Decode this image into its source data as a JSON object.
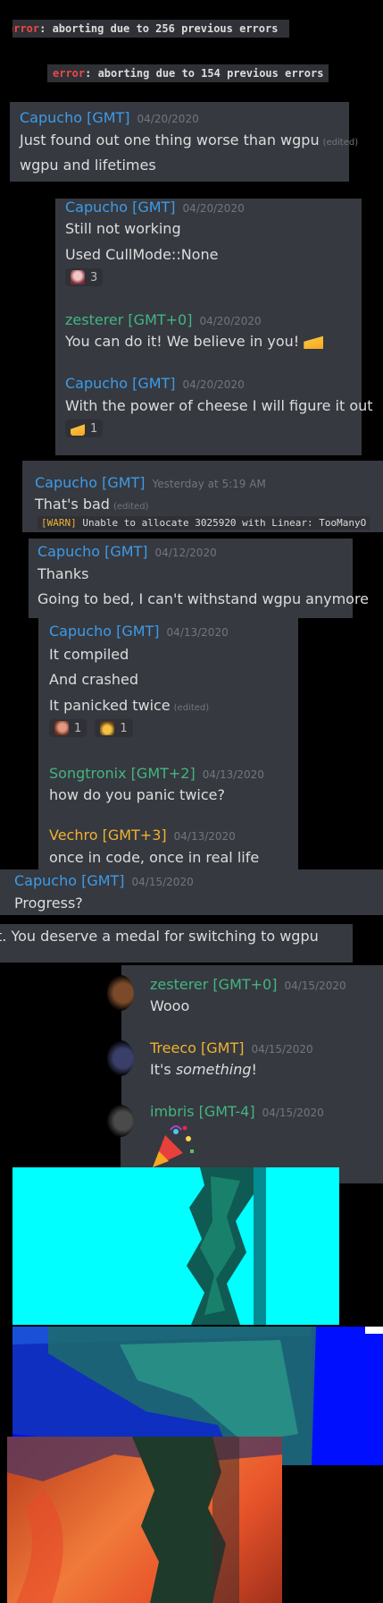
{
  "errors": [
    {
      "prefix": "error",
      "text": ": aborting due to 256 previous errors"
    },
    {
      "prefix": "error",
      "text": ": aborting due to 154 previous errors"
    }
  ],
  "block1": {
    "author": "Capucho [GMT]",
    "timestamp": "04/20/2020",
    "lines": [
      "Just found out one thing worse  than wgpu",
      "wgpu and lifetimes"
    ],
    "edited": "(edited)"
  },
  "block2": {
    "author": "Capucho [GMT]",
    "timestamp": "04/20/2020",
    "lines": [
      "Still not working",
      "Used CullMode::None"
    ],
    "reaction_count": "3",
    "m2_author": "zesterer [GMT+0]",
    "m2_timestamp": "04/20/2020",
    "m2_text": "You can do it! We believe in you!",
    "m3_author": "Capucho [GMT]",
    "m3_timestamp": "04/20/2020",
    "m3_text": "With the power of cheese I will figure it out",
    "cheese_count": "1"
  },
  "block3": {
    "author": "Capucho [GMT]",
    "timestamp": "Yesterday at 5:19 AM",
    "text": "That's bad",
    "edited": "(edited)",
    "warn_tag": "[WARN]",
    "warn_text": " Unable to allocate 3025920 with Linear: TooManyO"
  },
  "block4": {
    "author": "Capucho [GMT]",
    "timestamp": "04/12/2020",
    "lines": [
      "Thanks",
      "Going to bed, I can't withstand wgpu anymore"
    ]
  },
  "block5": {
    "author": "Capucho [GMT]",
    "timestamp": "04/13/2020",
    "lines": [
      "It compiled",
      "And crashed",
      "It panicked twice"
    ],
    "edited": "(edited)",
    "react1_count": "1",
    "react2_count": "1",
    "m2_author": "Songtronix [GMT+2]",
    "m2_timestamp": "04/13/2020",
    "m2_text": "how do you panic twice?",
    "m3_author": "Vechro [GMT+3]",
    "m3_timestamp": "04/13/2020",
    "m3_text": "once in code, once in real life"
  },
  "block6": {
    "author": "Capucho [GMT]",
    "timestamp": "04/15/2020",
    "text": "Progress?"
  },
  "block7": {
    "text": "t. You deserve a medal for switching to wgpu"
  },
  "block8": {
    "m1_author": "zesterer [GMT+0]",
    "m1_timestamp": "04/15/2020",
    "m1_text": "Wooo",
    "m2_author": "Treeco [GMT]",
    "m2_timestamp": "04/15/2020",
    "m2_pre": "It's ",
    "m2_em": "something",
    "m2_post": "!",
    "m3_author": "imbris [GMT-4]",
    "m3_timestamp": "04/15/2020"
  },
  "colors": {
    "panel": "#36393f",
    "blue_name": "#3d9be9",
    "green_name": "#43b581",
    "orange_name": "#f0b132",
    "error": "#f04747",
    "cyan": "#00ffff",
    "blue_bg": "#0010ff"
  }
}
